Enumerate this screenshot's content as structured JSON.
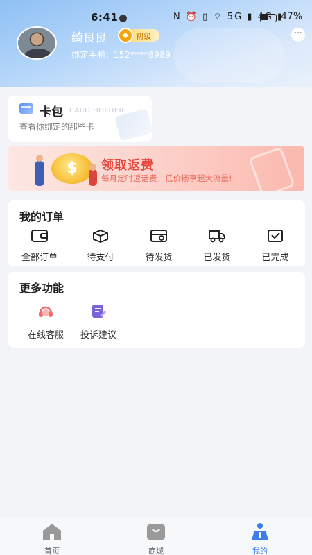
{
  "status_bar": {
    "time": "6:41",
    "network": "N ⏰ ▯ ⌔ 5G ▮ 4G ▮",
    "battery": "47%"
  },
  "profile": {
    "name": "绮良良",
    "level": "初级",
    "phone_label": "绑定手机:",
    "phone": "152****8989",
    "more": "···"
  },
  "card_holder": {
    "title": "卡包",
    "en_title": "CARD HOLDER",
    "subtitle": "查看你绑定的那些卡"
  },
  "banner": {
    "title": "领取返费",
    "subtitle": "每月定时返话费，低价畅享超大流量!"
  },
  "orders": {
    "title": "我的订单",
    "items": [
      {
        "label": "全部订单",
        "icon": "wallet-icon"
      },
      {
        "label": "待支付",
        "icon": "box-icon"
      },
      {
        "label": "待发货",
        "icon": "shipping-box-icon"
      },
      {
        "label": "已发货",
        "icon": "truck-icon"
      },
      {
        "label": "已完成",
        "icon": "inbox-check-icon"
      }
    ]
  },
  "features": {
    "title": "更多功能",
    "items": [
      {
        "label": "在线客服",
        "icon": "headset-icon",
        "color": "#f06b6b"
      },
      {
        "label": "投诉建议",
        "icon": "edit-note-icon",
        "color": "#7b63d9"
      }
    ]
  },
  "tabs": [
    {
      "label": "首页",
      "icon": "home-icon"
    },
    {
      "label": "商城",
      "icon": "shop-bag-icon"
    },
    {
      "label": "我的",
      "icon": "profile-icon",
      "active": true,
      "color": "#3d7dea"
    }
  ]
}
